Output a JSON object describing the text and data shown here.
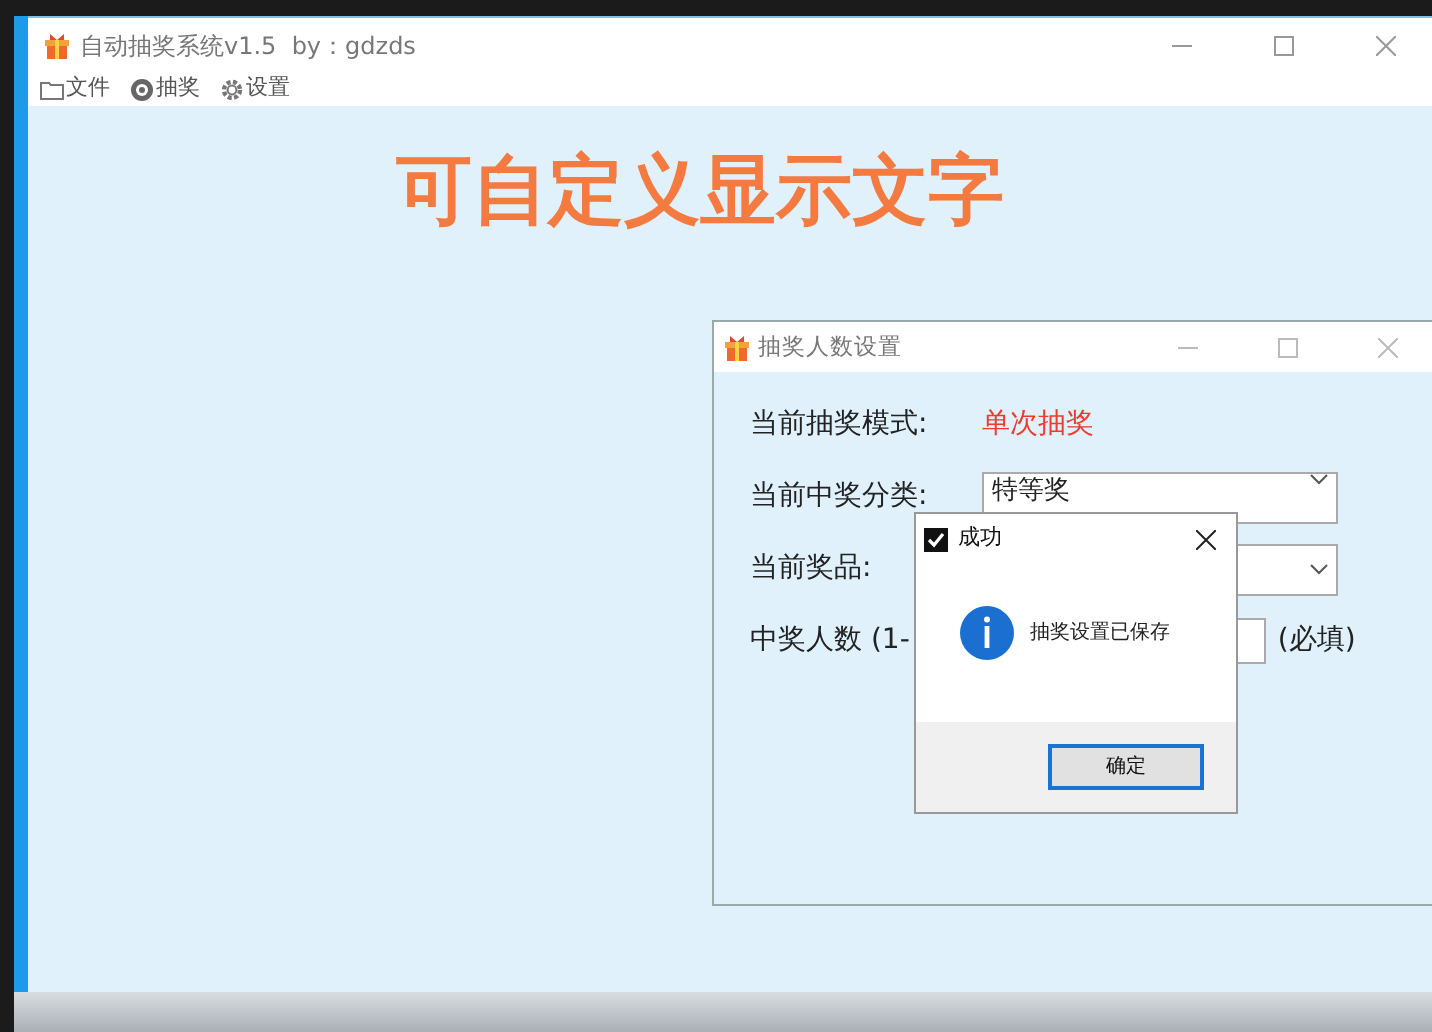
{
  "main_window": {
    "title": "自动抽奖系统v1.5  by：gdzds",
    "menu": [
      {
        "label": "文件"
      },
      {
        "label": "抽奖"
      },
      {
        "label": "设置"
      }
    ],
    "banner": "可自定义显示文字"
  },
  "settings_dialog": {
    "title": "抽奖人数设置",
    "mode_label": "当前抽奖模式:",
    "mode_value": "单次抽奖",
    "category_label": "当前中奖分类:",
    "category_value": "特等奖",
    "prize_label": "当前奖品:",
    "count_label": "中奖人数 (1-",
    "required_note": "(必填)"
  },
  "message_box": {
    "title": "成功",
    "message": "抽奖设置已保存",
    "button": "确定"
  }
}
